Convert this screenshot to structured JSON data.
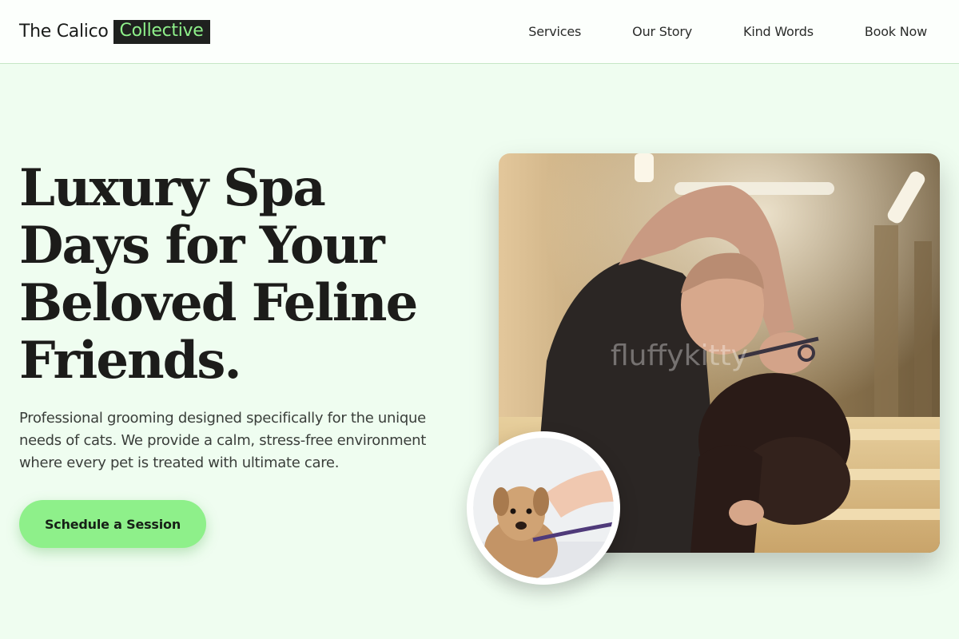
{
  "brand": {
    "name_plain": "The Calico",
    "name_highlight": "Collective",
    "highlight_bg": "#1f211f",
    "highlight_color": "#8ef08a"
  },
  "nav": {
    "items": [
      {
        "label": "Services"
      },
      {
        "label": "Our Story"
      },
      {
        "label": "Kind Words"
      },
      {
        "label": "Book Now"
      }
    ]
  },
  "hero": {
    "title_lines": [
      "Luxury Spa",
      "Days for Your",
      "Beloved Feline",
      "Friends."
    ],
    "subtitle": "Professional grooming designed specifically for the unique needs of cats. We provide a calm, stress-free environment where every pet is treated with ultimate care.",
    "cta_label": "Schedule a Session",
    "cta_color": "#8ef08a"
  },
  "images": {
    "main_photo": {
      "icon": "groomer-trimming-dog-photo",
      "watermark": "fluffykitty"
    },
    "inset_photo": {
      "icon": "wet-dog-bath-photo"
    }
  },
  "colors": {
    "page_bg": "#effdf0",
    "header_bg": "#fcfffc",
    "text_dark": "#1c1c1a"
  }
}
